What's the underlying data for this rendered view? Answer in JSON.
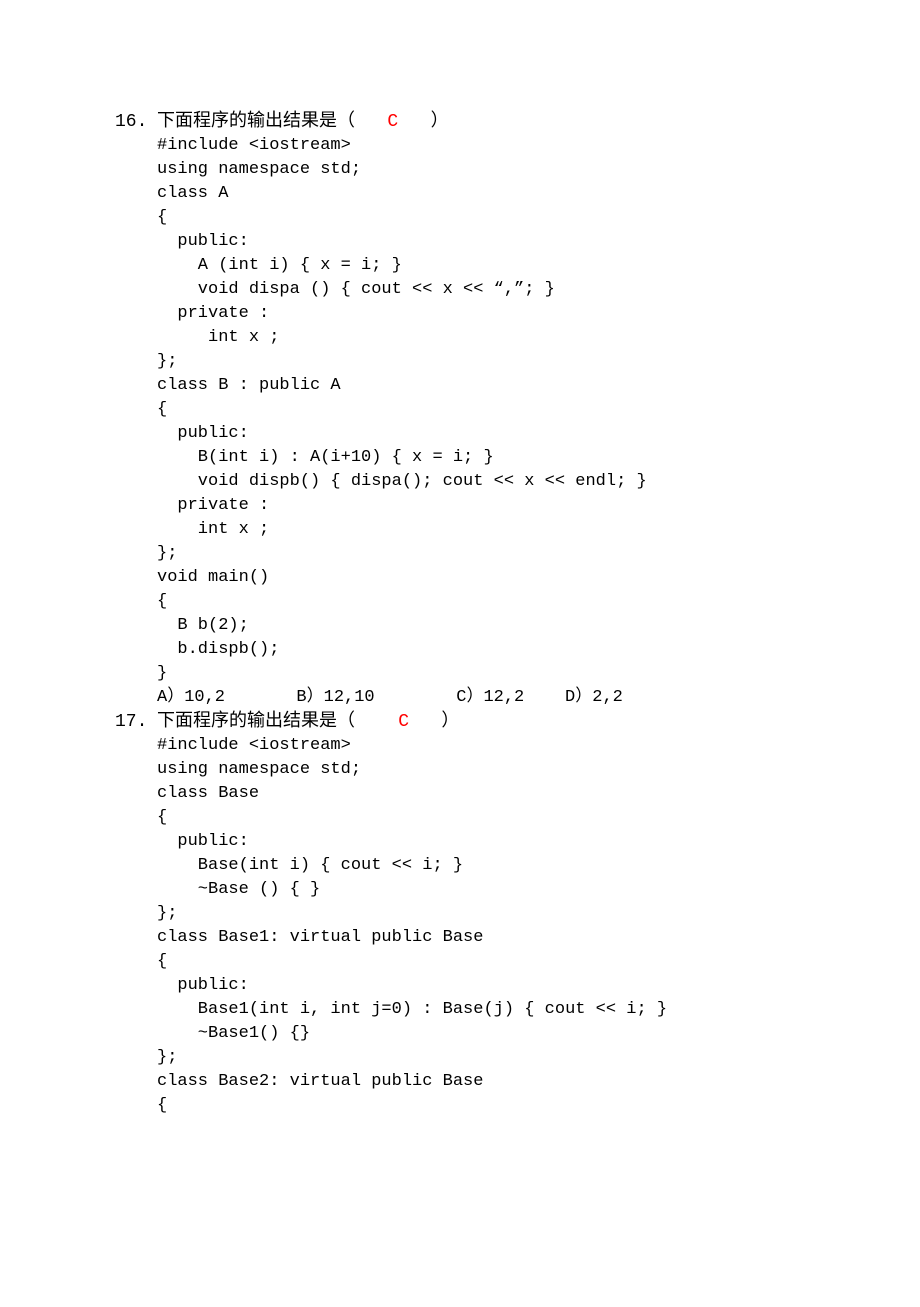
{
  "questions": [
    {
      "number": "16.",
      "stem_prefix": "下面程序的输出结果是（   ",
      "answer": "C",
      "stem_suffix": "   ）",
      "code": "#include <iostream>\nusing namespace std;\nclass A\n{\n  public:\n    A (int i) { x = i; }\n    void dispa () { cout << x << “,”; }\n  private :\n     int x ;\n};\nclass B : public A\n{\n  public:\n    B(int i) : A(i+10) { x = i; }\n    void dispb() { dispa(); cout << x << endl; }\n  private :\n    int x ;\n};\nvoid main()\n{\n  B b(2);\n  b.dispb();\n}",
      "options": "A）10,2       B）12,10        C）12,2    D）2,2"
    },
    {
      "number": "17.",
      "stem_prefix": "下面程序的输出结果是（    ",
      "answer": "C",
      "stem_suffix": "   ）",
      "code": "#include <iostream>\nusing namespace std;\nclass Base\n{\n  public:\n    Base(int i) { cout << i; }\n    ~Base () { }\n};\nclass Base1: virtual public Base\n{\n  public:\n    Base1(int i, int j=0) : Base(j) { cout << i; }\n    ~Base1() {}\n};\nclass Base2: virtual public Base\n{",
      "options": ""
    }
  ]
}
